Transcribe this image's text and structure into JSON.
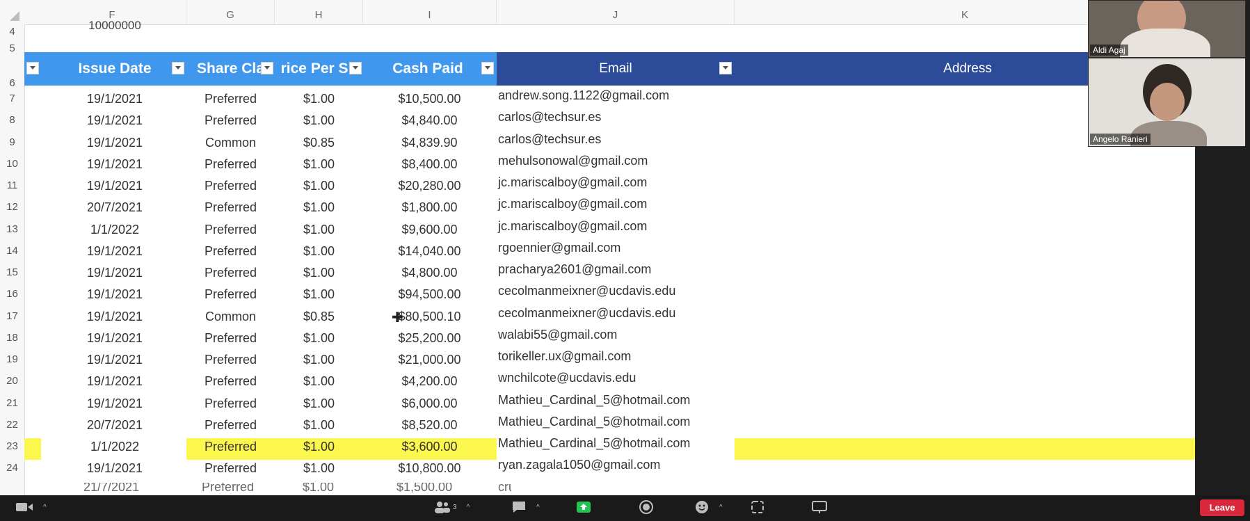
{
  "columns": [
    "F",
    "G",
    "H",
    "I",
    "J",
    "K"
  ],
  "partial_cell_value": "10000000",
  "header_row": {
    "issue_date": "Issue Date",
    "share_class": "Share Cla",
    "price_per_share": "rice Per Sh",
    "cash_paid": "Cash Paid",
    "email": "Email",
    "address": "Address"
  },
  "row_numbers": [
    "4",
    "5",
    "6",
    "7",
    "8",
    "9",
    "10",
    "11",
    "12",
    "13",
    "14",
    "15",
    "16",
    "17",
    "18",
    "19",
    "20",
    "21",
    "22",
    "23",
    "24"
  ],
  "rows": [
    {
      "row": "7",
      "date": "19/1/2021",
      "class": "Preferred",
      "price": "$1.00",
      "cash": "$10,500.00",
      "email": "andrew.song.1122@gmail.com"
    },
    {
      "row": "8",
      "date": "19/1/2021",
      "class": "Preferred",
      "price": "$1.00",
      "cash": "$4,840.00",
      "email": "carlos@techsur.es"
    },
    {
      "row": "9",
      "date": "19/1/2021",
      "class": "Common",
      "price": "$0.85",
      "cash": "$4,839.90",
      "email": "carlos@techsur.es"
    },
    {
      "row": "10",
      "date": "19/1/2021",
      "class": "Preferred",
      "price": "$1.00",
      "cash": "$8,400.00",
      "email": "mehulsonowal@gmail.com"
    },
    {
      "row": "11",
      "date": "19/1/2021",
      "class": "Preferred",
      "price": "$1.00",
      "cash": "$20,280.00",
      "email": "jc.mariscalboy@gmail.com"
    },
    {
      "row": "12",
      "date": "20/7/2021",
      "class": "Preferred",
      "price": "$1.00",
      "cash": "$1,800.00",
      "email": "jc.mariscalboy@gmail.com"
    },
    {
      "row": "13",
      "date": "1/1/2022",
      "class": "Preferred",
      "price": "$1.00",
      "cash": "$9,600.00",
      "email": "jc.mariscalboy@gmail.com"
    },
    {
      "row": "14",
      "date": "19/1/2021",
      "class": "Preferred",
      "price": "$1.00",
      "cash": "$14,040.00",
      "email": "rgoennier@gmail.com"
    },
    {
      "row": "15",
      "date": "19/1/2021",
      "class": "Preferred",
      "price": "$1.00",
      "cash": "$4,800.00",
      "email": "pracharya2601@gmail.com"
    },
    {
      "row": "16",
      "date": "19/1/2021",
      "class": "Preferred",
      "price": "$1.00",
      "cash": "$94,500.00",
      "email": "cecolmanmeixner@ucdavis.edu"
    },
    {
      "row": "17",
      "date": "19/1/2021",
      "class": "Common",
      "price": "$0.85",
      "cash": "$80,500.10",
      "email": "cecolmanmeixner@ucdavis.edu"
    },
    {
      "row": "18",
      "date": "19/1/2021",
      "class": "Preferred",
      "price": "$1.00",
      "cash": "$25,200.00",
      "email": "walabi55@gmail.com"
    },
    {
      "row": "19",
      "date": "19/1/2021",
      "class": "Preferred",
      "price": "$1.00",
      "cash": "$21,000.00",
      "email": "torikeller.ux@gmail.com"
    },
    {
      "row": "20",
      "date": "19/1/2021",
      "class": "Preferred",
      "price": "$1.00",
      "cash": "$4,200.00",
      "email": "wnchilcote@ucdavis.edu"
    },
    {
      "row": "21",
      "date": "19/1/2021",
      "class": "Preferred",
      "price": "$1.00",
      "cash": "$6,000.00",
      "email": "Mathieu_Cardinal_5@hotmail.com"
    },
    {
      "row": "22",
      "date": "20/7/2021",
      "class": "Preferred",
      "price": "$1.00",
      "cash": "$8,520.00",
      "email": "Mathieu_Cardinal_5@hotmail.com"
    },
    {
      "row": "23",
      "date": "1/1/2022",
      "class": "Preferred",
      "price": "$1.00",
      "cash": "$3,600.00",
      "email": "Mathieu_Cardinal_5@hotmail.com",
      "highlighted": true
    },
    {
      "row": "24",
      "date": "19/1/2021",
      "class": "Preferred",
      "price": "$1.00",
      "cash": "$10,800.00",
      "email": "ryan.zagala1050@gmail.com"
    }
  ],
  "participants": [
    {
      "name": "Aldi Agaj"
    },
    {
      "name": "Angelo Ranieri"
    }
  ],
  "toolbar": {
    "participants_count": "3",
    "leave_label": "Leave",
    "icons": [
      "video-camera-icon",
      "participants-icon",
      "chat-icon",
      "share-screen-icon",
      "record-icon",
      "reactions-icon",
      "apps-icon",
      "whiteboard-icon"
    ]
  },
  "colors": {
    "header_blue": "#3f97ee",
    "header_navy": "#2c4c9a",
    "highlight_yellow": "#fbf74c",
    "leave_red": "#d9283b"
  }
}
